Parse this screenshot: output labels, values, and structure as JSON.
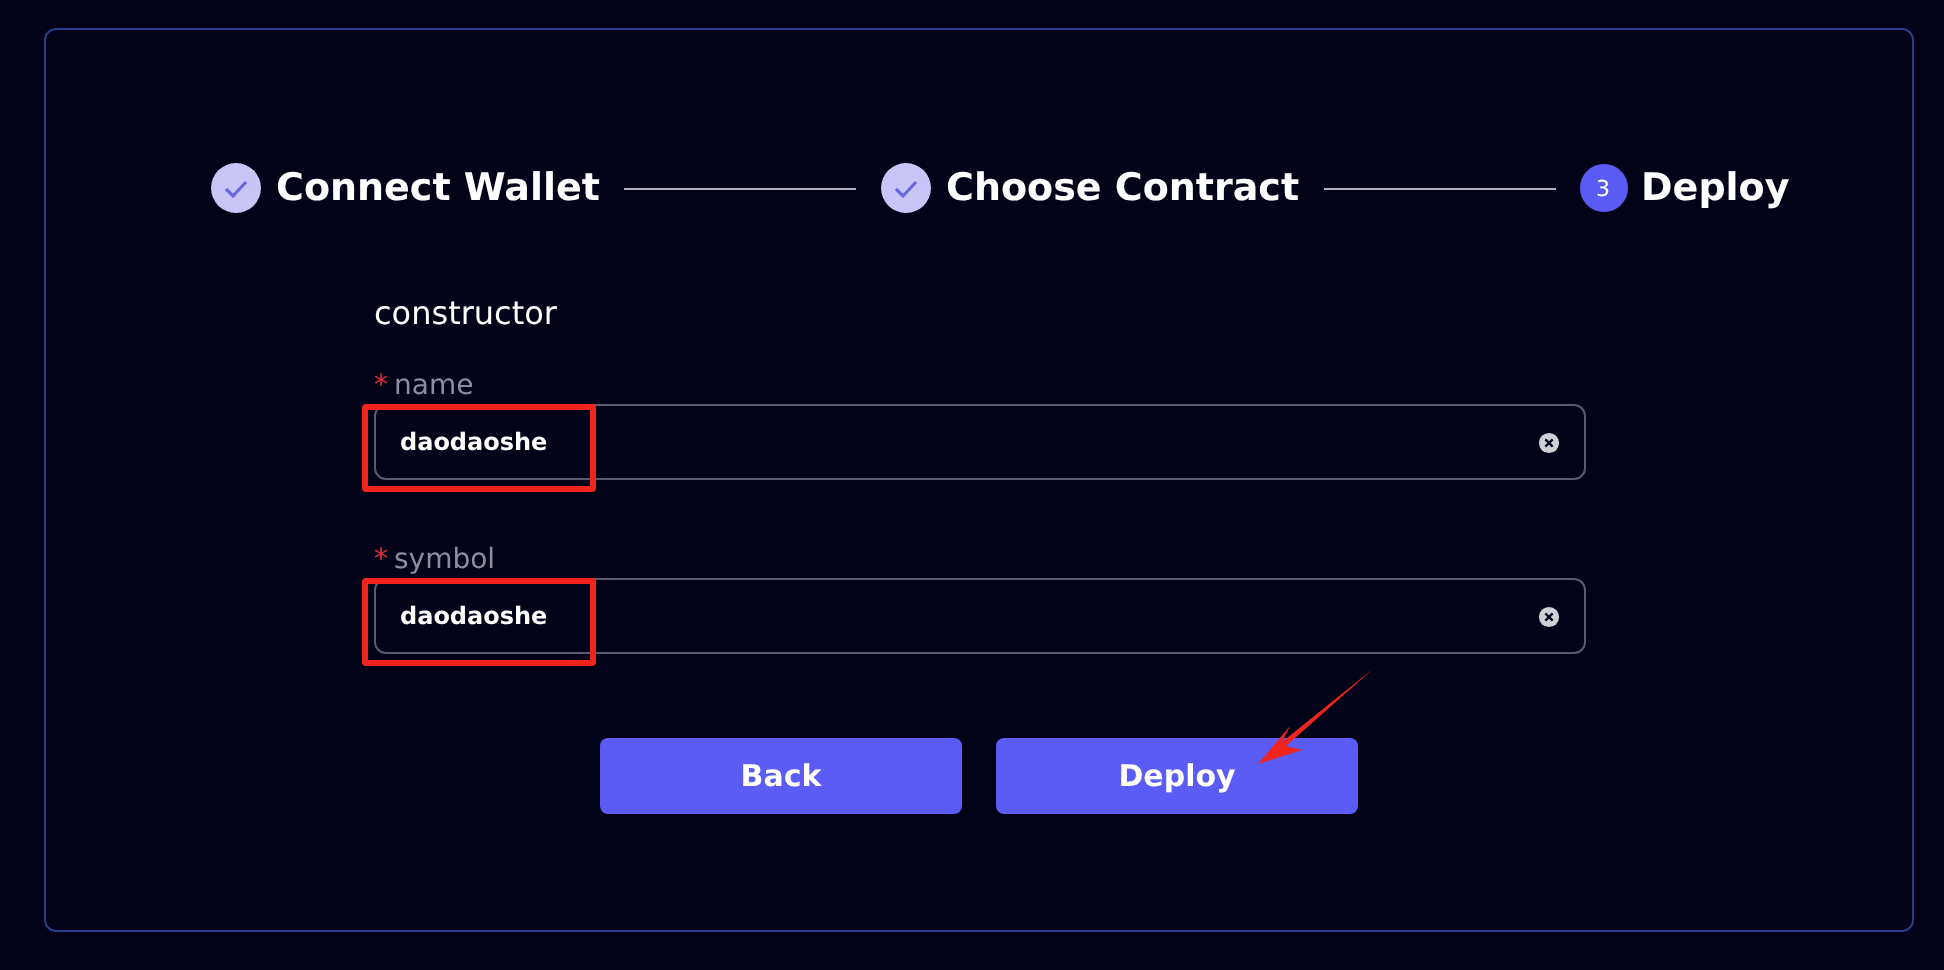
{
  "steps": [
    {
      "label": "Connect Wallet",
      "done": true
    },
    {
      "label": "Choose Contract",
      "done": true
    },
    {
      "label": "Deploy",
      "done": false,
      "number": "3"
    }
  ],
  "form": {
    "title": "constructor",
    "fields": [
      {
        "marker": "*",
        "label": "name",
        "value": "daodaoshe"
      },
      {
        "marker": "*",
        "label": "symbol",
        "value": "daodaoshe"
      }
    ]
  },
  "buttons": [
    "Back",
    "Deploy"
  ]
}
